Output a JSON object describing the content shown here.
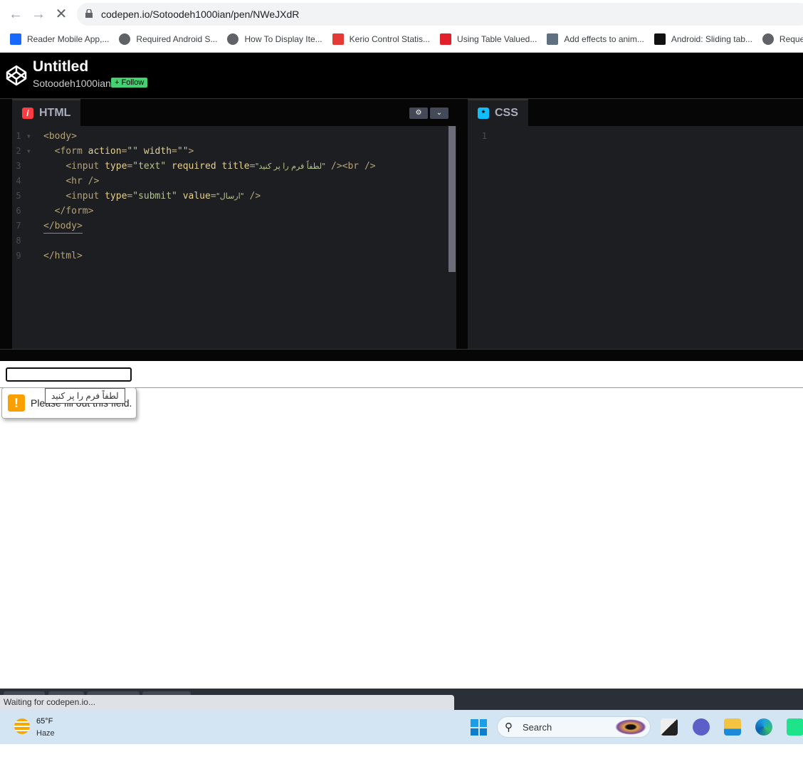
{
  "browser": {
    "url": "codepen.io/Sotoodeh1000ian/pen/NWeJXdR",
    "bookmarks": [
      {
        "label": "Reader Mobile App,...",
        "icon": "behance-icon",
        "color": "#1769ff"
      },
      {
        "label": "Required Android S...",
        "icon": "globe-icon",
        "color": "#5f6368"
      },
      {
        "label": "How To Display Ite...",
        "icon": "globe-icon",
        "color": "#5f6368"
      },
      {
        "label": "Kerio Control Statis...",
        "icon": "kerio-shield-icon",
        "color": "#e53935"
      },
      {
        "label": "Using Table Valued...",
        "icon": "table-icon",
        "color": "#e0202a"
      },
      {
        "label": "Add effects to anim...",
        "icon": "gif-film-icon",
        "color": "#607080"
      },
      {
        "label": "Android: Sliding tab...",
        "icon": "medium-icon",
        "color": "#111111"
      },
      {
        "label": "Reque",
        "icon": "globe-icon",
        "color": "#5f6368"
      }
    ]
  },
  "codepen": {
    "title": "Untitled",
    "user": "Sotoodeh1000ian",
    "follow": "+ Follow"
  },
  "html_pane": {
    "label": "HTML",
    "lines": [
      [
        [
          "tag",
          "<body>"
        ]
      ],
      [
        [
          "txt",
          "  "
        ],
        [
          "tag",
          "<form "
        ],
        [
          "attr",
          "action"
        ],
        [
          "tag",
          "="
        ],
        [
          "str",
          "\"\""
        ],
        [
          "txt",
          " "
        ],
        [
          "attr",
          "width"
        ],
        [
          "tag",
          "="
        ],
        [
          "str",
          "\"\""
        ],
        [
          "tag",
          ">"
        ]
      ],
      [
        [
          "txt",
          "    "
        ],
        [
          "tag",
          "<input "
        ],
        [
          "attr",
          "type"
        ],
        [
          "tag",
          "="
        ],
        [
          "str",
          "\"text\""
        ],
        [
          "txt",
          " "
        ],
        [
          "attr",
          "required"
        ],
        [
          "txt",
          " "
        ],
        [
          "attr",
          "title"
        ],
        [
          "tag",
          "="
        ],
        [
          "str",
          "\"لطفاً فرم را پر کنید\""
        ],
        [
          "tag",
          " /><br />"
        ]
      ],
      [
        [
          "txt",
          "    "
        ],
        [
          "tag",
          "<hr />"
        ]
      ],
      [
        [
          "txt",
          "    "
        ],
        [
          "tag",
          "<input "
        ],
        [
          "attr",
          "type"
        ],
        [
          "tag",
          "="
        ],
        [
          "str",
          "\"submit\""
        ],
        [
          "txt",
          " "
        ],
        [
          "attr",
          "value"
        ],
        [
          "tag",
          "="
        ],
        [
          "str",
          "\"ارسال\""
        ],
        [
          "tag",
          " />"
        ]
      ],
      [
        [
          "txt",
          "  "
        ],
        [
          "tag",
          "</form>"
        ]
      ],
      [
        [
          "tag",
          "</body>"
        ]
      ],
      [],
      [
        [
          "tag",
          "</html>"
        ]
      ]
    ]
  },
  "css_pane": {
    "label": "CSS",
    "lines": [
      "1"
    ]
  },
  "preview": {
    "validation_message": "Please fill out this field.",
    "tooltip": "لطفاً فرم را پر کنید"
  },
  "status": "Waiting for codepen.io...",
  "taskbar": {
    "temp": "65°F",
    "weather": "Haze",
    "search": "Search"
  }
}
